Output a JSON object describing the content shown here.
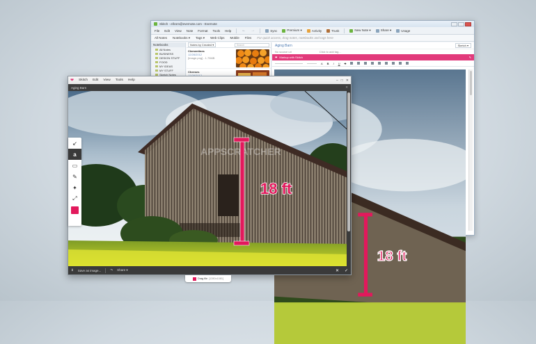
{
  "evernote": {
    "title": "Skitch - ellcsm@evernote.com - Evernote",
    "menu": [
      "File",
      "Edit",
      "View",
      "Note",
      "Format",
      "Tools",
      "Help"
    ],
    "toolbar": {
      "sync": "Sync",
      "premium": "Premium ▾",
      "activity": "Activity",
      "trunk": "Trunk",
      "new_note": "New Note ▾",
      "share": "Share ▾",
      "usage": "Usage"
    },
    "bar2": {
      "all_notes": "All Notes",
      "notebooks": "Notebooks ▾",
      "tags": "Tags ▾",
      "web_clips": "Web Clips",
      "mobile": "Mobile",
      "files": "Files",
      "hint": "For quick access, drag notes, notebooks and tags here"
    },
    "sidebar": {
      "header": "Notebooks",
      "items": [
        "All Notes",
        "BUSINESS",
        "DESIGN STUFF",
        "FOOD",
        "MY IDEAS",
        "MY STUFF",
        "Sketch Notes"
      ]
    },
    "notes": {
      "sort": "Notes by Created ▾",
      "search_placeholder": "Search",
      "list": [
        {
          "title": "Clementines",
          "date": "12/28/2012",
          "snippet": "[Image.png] - 1.75MB"
        },
        {
          "title": "Cheeses",
          "date": "12/28/2012",
          "snippet": ""
        }
      ]
    },
    "editor": {
      "note_title": "Aging Barn",
      "notebook": "Sketch ▾",
      "source": "No source url",
      "tag": "Click to add tag...",
      "markup": "Markup with Skitch"
    }
  },
  "skitch": {
    "app_name": "Skitch",
    "menu": [
      "Edit",
      "View",
      "Tools",
      "Help"
    ],
    "document": "Aging Barn",
    "annotation": "18 ft",
    "watermark": "APPSCRATCHER",
    "accent": "#e2195c",
    "tools": [
      {
        "name": "arrow-tool-icon",
        "glyph": "↙"
      },
      {
        "name": "text-tool-icon",
        "glyph": "a"
      },
      {
        "name": "rectangle-tool-icon",
        "glyph": "▭"
      },
      {
        "name": "marker-tool-icon",
        "glyph": "✎"
      },
      {
        "name": "pixelate-tool-icon",
        "glyph": "✦"
      },
      {
        "name": "crop-tool-icon",
        "glyph": "⤢"
      }
    ],
    "bottom": {
      "save": "Save as image...",
      "share": "Share ▾"
    },
    "drag_file": {
      "label": "Drag file",
      "dims": "[1280x1081]"
    }
  }
}
